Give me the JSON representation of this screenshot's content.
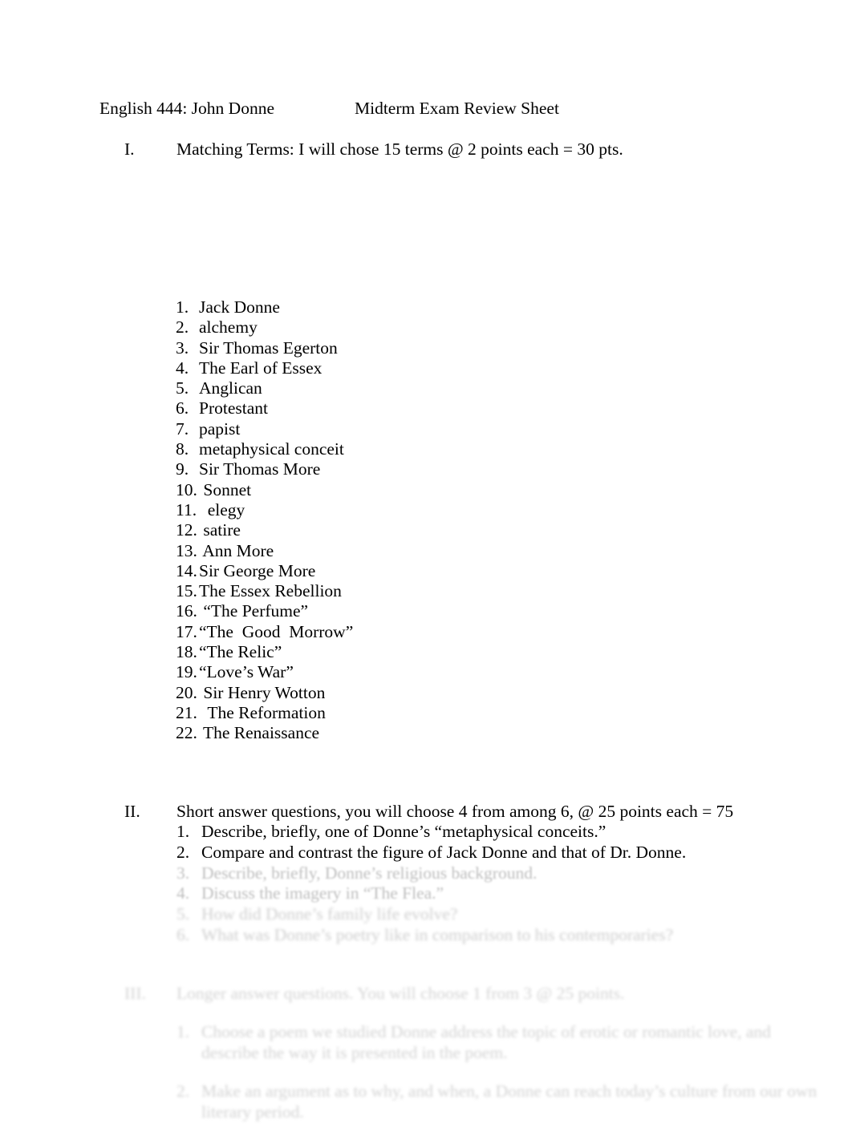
{
  "document": {
    "header": {
      "course": "English 444: John Donne",
      "sheet_title": "Midterm Exam Review Sheet"
    },
    "sections": [
      {
        "numeral": "I.",
        "heading": "Matching Terms: I will chose 15 terms @ 2 points each = 30 pts.",
        "terms": [
          {
            "n": "1.",
            "text": "Jack Donne"
          },
          {
            "n": "2.",
            "text": "alchemy"
          },
          {
            "n": "3.",
            "text": "Sir Thomas Egerton"
          },
          {
            "n": "4.",
            "text": "The Earl of Essex"
          },
          {
            "n": "5.",
            "text": "Anglican"
          },
          {
            "n": "6.",
            "text": "Protestant"
          },
          {
            "n": "7.",
            "text": "papist"
          },
          {
            "n": "8.",
            "text": "metaphysical conceit"
          },
          {
            "n": "9.",
            "text": "Sir Thomas More"
          },
          {
            "n": "10.",
            "text": " Sonnet"
          },
          {
            "n": "11.",
            "text": "  elegy"
          },
          {
            "n": "12.",
            "text": " satire"
          },
          {
            "n": "13.",
            "text": " Ann More"
          },
          {
            "n": "14.",
            "text": "Sir George More"
          },
          {
            "n": "15.",
            "text": "The Essex Rebellion"
          },
          {
            "n": "16.",
            "text": " “The Perfume”"
          },
          {
            "n": "17.",
            "text": "“The  Good  Morrow”"
          },
          {
            "n": "18.",
            "text": "“The Relic”"
          },
          {
            "n": "19.",
            "text": "“Love’s War”"
          },
          {
            "n": "20.",
            "text": " Sir Henry Wotton"
          },
          {
            "n": "21.",
            "text": "  The Reformation"
          },
          {
            "n": "22.",
            "text": " The Renaissance"
          }
        ]
      },
      {
        "numeral": "II.",
        "heading": "Short answer questions, you will choose 4 from among 6, @ 25 points each = 75",
        "questions": [
          {
            "n": "1.",
            "text": "Describe, briefly, one of Donne’s “metaphysical conceits.”",
            "fade": "none"
          },
          {
            "n": "2.",
            "text": "Compare and contrast the figure of Jack Donne and that of Dr. Donne.",
            "fade": "none"
          },
          {
            "n": "3.",
            "text": "Describe, briefly, Donne’s religious background.",
            "fade": "fade-1"
          },
          {
            "n": "4.",
            "text": "Discuss the imagery in “The Flea.”",
            "fade": "fade-1"
          },
          {
            "n": "5.",
            "text": "How did Donne’s family life evolve?",
            "fade": "fade-2"
          },
          {
            "n": "6.",
            "text": "What was Donne’s poetry like in comparison to his contemporaries?",
            "fade": "fade-2"
          }
        ]
      },
      {
        "numeral": "III.",
        "heading": "Longer answer questions. You will choose 1 from 3 @ 25 points.",
        "questions": [
          {
            "n": "1.",
            "text": "Choose a poem we studied Donne address the topic of erotic or romantic love, and describe the way it is presented in the poem.",
            "fade": "fade-3"
          },
          {
            "n": "2.",
            "text": "Make an argument as to why, and when, a Donne can reach today’s culture from our own literary period.",
            "fade": "fade-3"
          }
        ]
      }
    ]
  }
}
